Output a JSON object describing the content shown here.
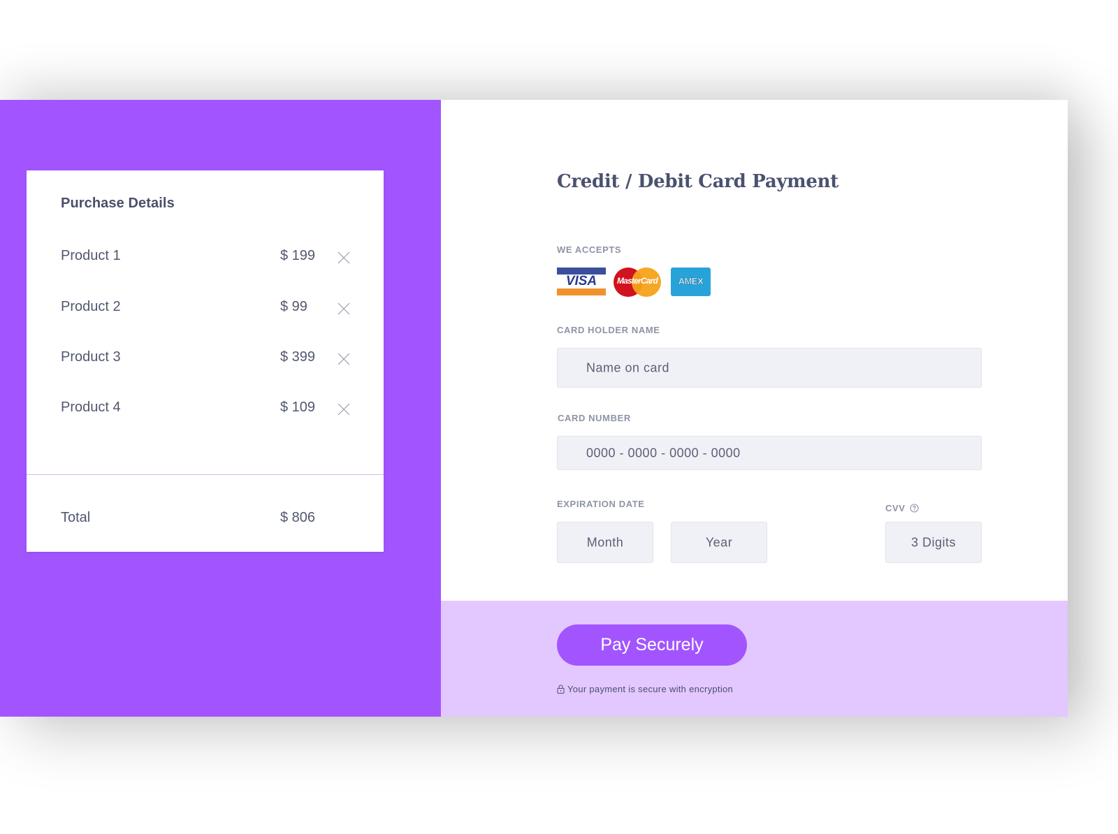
{
  "colors": {
    "brand_purple": "#a255ff",
    "band_lavender": "#e2c8ff",
    "text_dark": "#4a4f6a",
    "label_gray": "#8e93a6",
    "field_bg": "#f0f1f6",
    "divider": "#d7b6ec"
  },
  "purchase": {
    "title": "Purchase Details",
    "items": [
      {
        "name": "Product 1",
        "price": "$ 199",
        "remove_icon": "close-x-icon"
      },
      {
        "name": "Product 2",
        "price": "$ 99",
        "remove_icon": "close-x-icon"
      },
      {
        "name": "Product 3",
        "price": "$ 399",
        "remove_icon": "close-x-icon"
      },
      {
        "name": "Product 4",
        "price": "$ 109",
        "remove_icon": "close-x-icon"
      }
    ],
    "total_label": "Total",
    "total_value": "$ 806"
  },
  "payment": {
    "title": "Credit / Debit Card Payment",
    "accepts_label": "WE ACCEPTS",
    "cards": [
      {
        "name": "visa",
        "text": "VISA"
      },
      {
        "name": "mastercard",
        "text": "MasterCard"
      },
      {
        "name": "amex",
        "text": "AMEX"
      }
    ],
    "card_holder": {
      "label": "CARD HOLDER NAME",
      "placeholder": "Name on card"
    },
    "card_number": {
      "label": "CARD NUMBER",
      "placeholder": "0000 - 0000 - 0000 - 0000"
    },
    "expiration": {
      "label": "EXPIRATION DATE",
      "month_placeholder": "Month",
      "year_placeholder": "Year"
    },
    "cvv": {
      "label": "CVV",
      "icon": "help-circle-icon",
      "placeholder": "3 Digits"
    },
    "pay_button": "Pay Securely",
    "secure_note": "Your payment is secure with encryption",
    "secure_icon": "lock-icon"
  }
}
